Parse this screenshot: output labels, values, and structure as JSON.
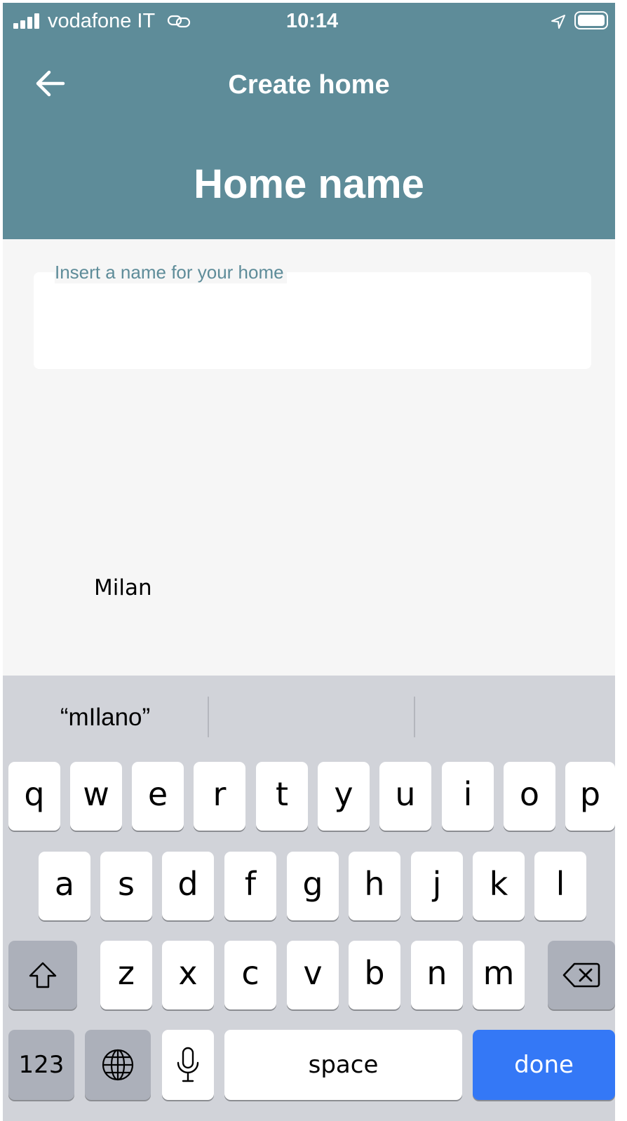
{
  "status_bar": {
    "carrier": "vodafone IT",
    "time": "10:14"
  },
  "header": {
    "nav_title": "Create home",
    "page_title": "Home name"
  },
  "form": {
    "field_label": "Insert a name for your home",
    "field_value": "Milan"
  },
  "keyboard": {
    "suggestions": [
      "“mIlano”",
      "",
      ""
    ],
    "rows": [
      [
        "q",
        "w",
        "e",
        "r",
        "t",
        "y",
        "u",
        "i",
        "o",
        "p"
      ],
      [
        "a",
        "s",
        "d",
        "f",
        "g",
        "h",
        "j",
        "k",
        "l"
      ],
      [
        "z",
        "x",
        "c",
        "v",
        "b",
        "n",
        "m"
      ]
    ],
    "numbers_key": "123",
    "space_key": "space",
    "done_key": "done"
  },
  "colors": {
    "header": "#5e8c99",
    "done": "#3478f6",
    "keyboard_bg": "#d1d3d9"
  }
}
